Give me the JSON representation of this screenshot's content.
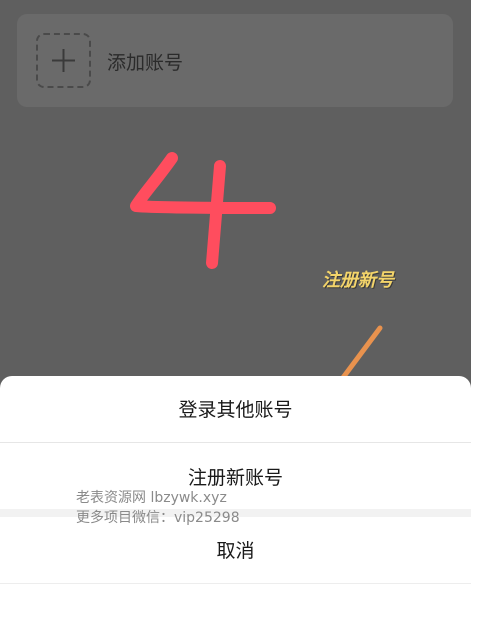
{
  "account_card": {
    "add_label": "添加账号",
    "add_icon": "plus-icon"
  },
  "annotation": {
    "step_number": "4",
    "hint_text": "注册新号",
    "number_color": "#ff4d5e",
    "arrow_color": "#e8924e"
  },
  "sheet": {
    "login_other": "登录其他账号",
    "register_new": "注册新账号",
    "cancel": "取消"
  },
  "watermark": {
    "line1": "老表资源网 lbzywk.xyz",
    "line2": "更多项目微信：vip25298"
  }
}
